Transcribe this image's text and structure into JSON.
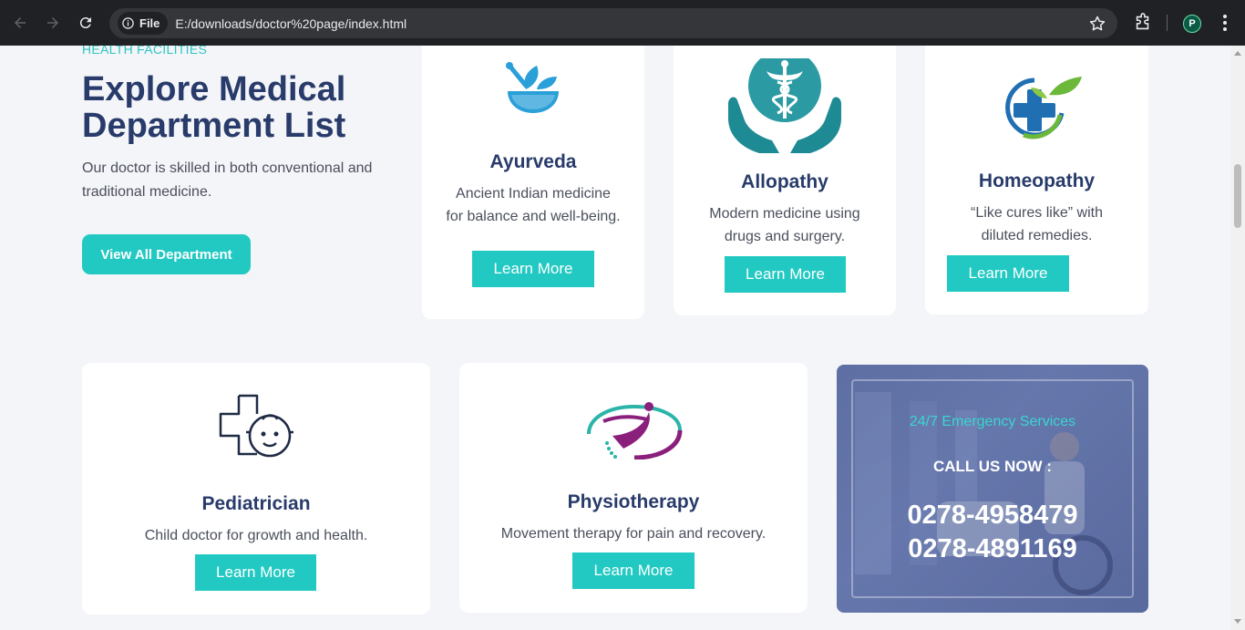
{
  "browser": {
    "site_chip": "File",
    "url": "E:/downloads/doctor%20page/index.html",
    "profile_initial": "P"
  },
  "hero": {
    "eyebrow": "HEALTH FACILITIES",
    "title": "Explore Medical Department List",
    "description": "Our doctor is skilled in both conventional and traditional medicine.",
    "cta_label": "View All Department"
  },
  "departments": [
    {
      "title": "Ayurveda",
      "description": "Ancient Indian medicine for balance and well-being.",
      "button": "Learn More",
      "icon": "mortar-pestle-leaf-icon"
    },
    {
      "title": "Allopathy",
      "description": "Modern medicine using drugs and surgery.",
      "button": "Learn More",
      "icon": "caduceus-hands-icon"
    },
    {
      "title": "Homeopathy",
      "description": "“Like cures like” with diluted remedies.",
      "button": "Learn More",
      "icon": "medical-cross-leaf-icon"
    },
    {
      "title": "Pediatrician",
      "description": "Child doctor for growth and health.",
      "button": "Learn More",
      "icon": "baby-cross-icon"
    },
    {
      "title": "Physiotherapy",
      "description": "Movement therapy for pain and recovery.",
      "button": "Learn More",
      "icon": "spine-figure-icon"
    }
  ],
  "emergency": {
    "subtitle": "24/7 Emergency Services",
    "call_label": "CALL US NOW :",
    "phones": [
      "0278-4958479",
      "0278-4891169"
    ]
  },
  "colors": {
    "accent": "#22c9c2",
    "heading": "#283b6a",
    "page_bg": "#f4f5f9"
  }
}
